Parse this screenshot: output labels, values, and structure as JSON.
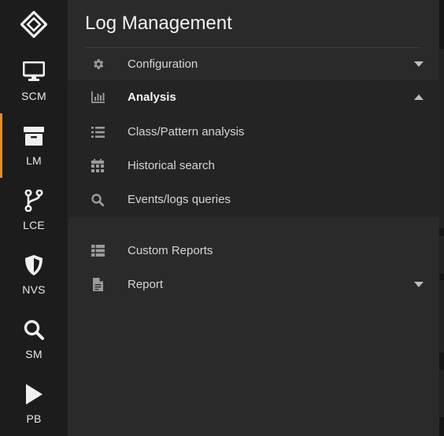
{
  "rail": {
    "items": [
      {
        "label": "SCM",
        "icon": "monitor-icon"
      },
      {
        "label": "LM",
        "icon": "archive-box-icon"
      },
      {
        "label": "LCE",
        "icon": "branch-icon"
      },
      {
        "label": "NVS",
        "icon": "shield-icon"
      },
      {
        "label": "SM",
        "icon": "search-icon"
      },
      {
        "label": "PB",
        "icon": "play-icon"
      }
    ],
    "active": "LM",
    "accent_color": "#f08c1e"
  },
  "panel": {
    "title": "Log Management",
    "menu": {
      "configuration": {
        "label": "Configuration",
        "icon": "gear-icon"
      },
      "analysis": {
        "label": "Analysis",
        "icon": "bar-chart-icon"
      },
      "class_pattern": {
        "label": "Class/Pattern analysis",
        "icon": "list-icon"
      },
      "historical": {
        "label": "Historical search",
        "icon": "calendar-icon"
      },
      "events_logs": {
        "label": "Events/logs queries",
        "icon": "search-icon"
      },
      "custom_reports": {
        "label": "Custom Reports",
        "icon": "table-icon"
      },
      "report": {
        "label": "Report",
        "icon": "document-icon"
      }
    }
  }
}
